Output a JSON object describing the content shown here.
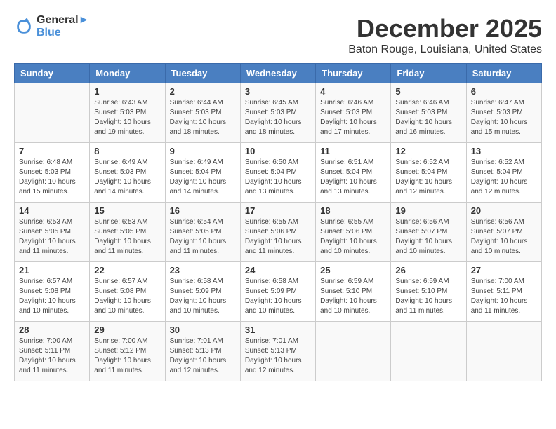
{
  "header": {
    "logo_line1": "General",
    "logo_line2": "Blue",
    "month_title": "December 2025",
    "subtitle": "Baton Rouge, Louisiana, United States"
  },
  "weekdays": [
    "Sunday",
    "Monday",
    "Tuesday",
    "Wednesday",
    "Thursday",
    "Friday",
    "Saturday"
  ],
  "weeks": [
    [
      {
        "day": "",
        "info": ""
      },
      {
        "day": "1",
        "info": "Sunrise: 6:43 AM\nSunset: 5:03 PM\nDaylight: 10 hours\nand 19 minutes."
      },
      {
        "day": "2",
        "info": "Sunrise: 6:44 AM\nSunset: 5:03 PM\nDaylight: 10 hours\nand 18 minutes."
      },
      {
        "day": "3",
        "info": "Sunrise: 6:45 AM\nSunset: 5:03 PM\nDaylight: 10 hours\nand 18 minutes."
      },
      {
        "day": "4",
        "info": "Sunrise: 6:46 AM\nSunset: 5:03 PM\nDaylight: 10 hours\nand 17 minutes."
      },
      {
        "day": "5",
        "info": "Sunrise: 6:46 AM\nSunset: 5:03 PM\nDaylight: 10 hours\nand 16 minutes."
      },
      {
        "day": "6",
        "info": "Sunrise: 6:47 AM\nSunset: 5:03 PM\nDaylight: 10 hours\nand 15 minutes."
      }
    ],
    [
      {
        "day": "7",
        "info": "Sunrise: 6:48 AM\nSunset: 5:03 PM\nDaylight: 10 hours\nand 15 minutes."
      },
      {
        "day": "8",
        "info": "Sunrise: 6:49 AM\nSunset: 5:03 PM\nDaylight: 10 hours\nand 14 minutes."
      },
      {
        "day": "9",
        "info": "Sunrise: 6:49 AM\nSunset: 5:04 PM\nDaylight: 10 hours\nand 14 minutes."
      },
      {
        "day": "10",
        "info": "Sunrise: 6:50 AM\nSunset: 5:04 PM\nDaylight: 10 hours\nand 13 minutes."
      },
      {
        "day": "11",
        "info": "Sunrise: 6:51 AM\nSunset: 5:04 PM\nDaylight: 10 hours\nand 13 minutes."
      },
      {
        "day": "12",
        "info": "Sunrise: 6:52 AM\nSunset: 5:04 PM\nDaylight: 10 hours\nand 12 minutes."
      },
      {
        "day": "13",
        "info": "Sunrise: 6:52 AM\nSunset: 5:04 PM\nDaylight: 10 hours\nand 12 minutes."
      }
    ],
    [
      {
        "day": "14",
        "info": "Sunrise: 6:53 AM\nSunset: 5:05 PM\nDaylight: 10 hours\nand 11 minutes."
      },
      {
        "day": "15",
        "info": "Sunrise: 6:53 AM\nSunset: 5:05 PM\nDaylight: 10 hours\nand 11 minutes."
      },
      {
        "day": "16",
        "info": "Sunrise: 6:54 AM\nSunset: 5:05 PM\nDaylight: 10 hours\nand 11 minutes."
      },
      {
        "day": "17",
        "info": "Sunrise: 6:55 AM\nSunset: 5:06 PM\nDaylight: 10 hours\nand 11 minutes."
      },
      {
        "day": "18",
        "info": "Sunrise: 6:55 AM\nSunset: 5:06 PM\nDaylight: 10 hours\nand 10 minutes."
      },
      {
        "day": "19",
        "info": "Sunrise: 6:56 AM\nSunset: 5:07 PM\nDaylight: 10 hours\nand 10 minutes."
      },
      {
        "day": "20",
        "info": "Sunrise: 6:56 AM\nSunset: 5:07 PM\nDaylight: 10 hours\nand 10 minutes."
      }
    ],
    [
      {
        "day": "21",
        "info": "Sunrise: 6:57 AM\nSunset: 5:08 PM\nDaylight: 10 hours\nand 10 minutes."
      },
      {
        "day": "22",
        "info": "Sunrise: 6:57 AM\nSunset: 5:08 PM\nDaylight: 10 hours\nand 10 minutes."
      },
      {
        "day": "23",
        "info": "Sunrise: 6:58 AM\nSunset: 5:09 PM\nDaylight: 10 hours\nand 10 minutes."
      },
      {
        "day": "24",
        "info": "Sunrise: 6:58 AM\nSunset: 5:09 PM\nDaylight: 10 hours\nand 10 minutes."
      },
      {
        "day": "25",
        "info": "Sunrise: 6:59 AM\nSunset: 5:10 PM\nDaylight: 10 hours\nand 10 minutes."
      },
      {
        "day": "26",
        "info": "Sunrise: 6:59 AM\nSunset: 5:10 PM\nDaylight: 10 hours\nand 11 minutes."
      },
      {
        "day": "27",
        "info": "Sunrise: 7:00 AM\nSunset: 5:11 PM\nDaylight: 10 hours\nand 11 minutes."
      }
    ],
    [
      {
        "day": "28",
        "info": "Sunrise: 7:00 AM\nSunset: 5:11 PM\nDaylight: 10 hours\nand 11 minutes."
      },
      {
        "day": "29",
        "info": "Sunrise: 7:00 AM\nSunset: 5:12 PM\nDaylight: 10 hours\nand 11 minutes."
      },
      {
        "day": "30",
        "info": "Sunrise: 7:01 AM\nSunset: 5:13 PM\nDaylight: 10 hours\nand 12 minutes."
      },
      {
        "day": "31",
        "info": "Sunrise: 7:01 AM\nSunset: 5:13 PM\nDaylight: 10 hours\nand 12 minutes."
      },
      {
        "day": "",
        "info": ""
      },
      {
        "day": "",
        "info": ""
      },
      {
        "day": "",
        "info": ""
      }
    ]
  ]
}
